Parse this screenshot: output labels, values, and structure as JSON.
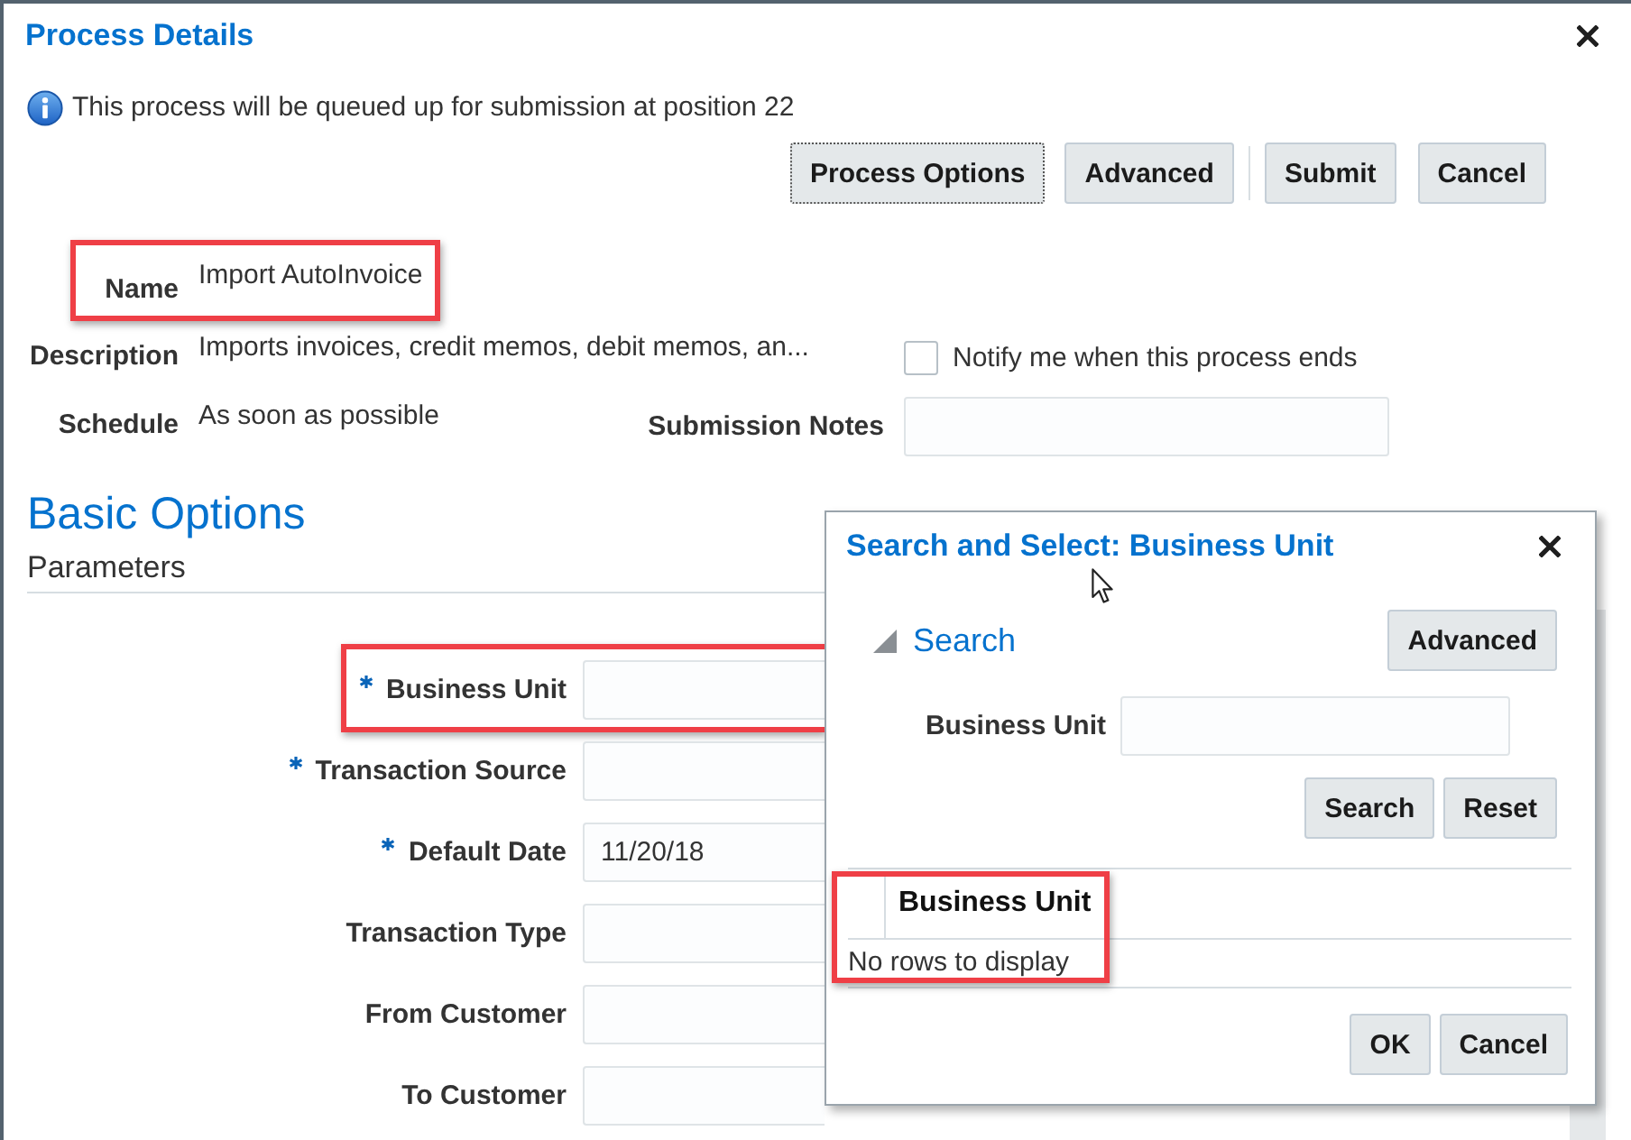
{
  "dialog": {
    "title": "Process Details"
  },
  "info_message": "This process will be queued up for submission at position 22",
  "button_groups": [
    {
      "buttons": [
        {
          "label": "Process Options",
          "focused": true
        },
        {
          "label": "Advanced",
          "focused": false
        }
      ]
    },
    {
      "buttons": [
        {
          "label": "Submit",
          "focused": false
        },
        {
          "label": "Cancel",
          "focused": false
        }
      ]
    }
  ],
  "details": {
    "name": {
      "label": "Name",
      "value": "Import AutoInvoice",
      "highlighted": true
    },
    "description": {
      "label": "Description",
      "value": "Imports invoices, credit memos, debit memos, an..."
    },
    "schedule": {
      "label": "Schedule",
      "value": "As soon as possible"
    },
    "notify": {
      "label": "Notify me when this process ends",
      "checked": false
    },
    "submission_notes": {
      "label": "Submission Notes"
    }
  },
  "section": {
    "title": "Basic Options",
    "subtitle": "Parameters"
  },
  "parameters": [
    {
      "label": "Business Unit",
      "required": true,
      "highlighted": true
    },
    {
      "label": "Transaction Source",
      "required": true,
      "highlighted": false
    },
    {
      "label": "Default Date",
      "required": true,
      "highlighted": false,
      "value": "11/20/18"
    },
    {
      "label": "Transaction Type",
      "required": false,
      "highlighted": false
    },
    {
      "label": "From Customer",
      "required": false,
      "highlighted": false
    },
    {
      "label": "To Customer",
      "required": false,
      "highlighted": false
    }
  ],
  "search_dialog": {
    "title": "Search and Select: Business Unit",
    "search_panel": {
      "title": "Search",
      "expanded": true,
      "advanced_button": {
        "label": "Advanced"
      },
      "fields": [
        {
          "label": "Business Unit"
        }
      ],
      "buttons": [
        {
          "label": "Search"
        },
        {
          "label": "Reset"
        }
      ]
    },
    "results": {
      "columns": [
        "Business Unit"
      ],
      "empty_message": "No rows to display",
      "highlighted": true
    },
    "buttons": [
      {
        "label": "OK"
      },
      {
        "label": "Cancel"
      }
    ]
  }
}
